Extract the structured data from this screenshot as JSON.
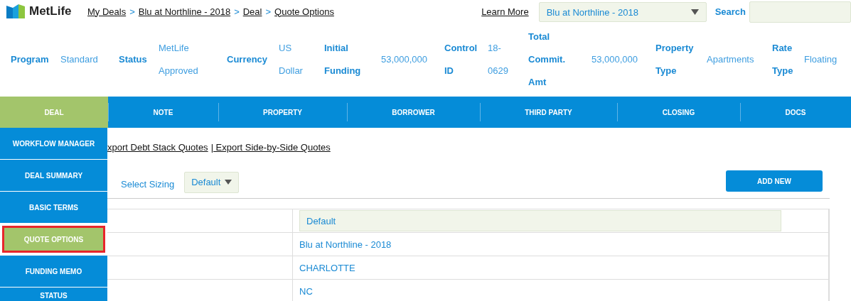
{
  "header": {
    "logo_text": "MetLife",
    "breadcrumb": [
      "My Deals",
      "Blu at Northline - 2018",
      "Deal",
      "Quote Options"
    ],
    "breadcrumb_separator": ">",
    "learn_more": "Learn More",
    "deal_select": "Blu at Northline - 2018",
    "search_label": "Search"
  },
  "summary": [
    {
      "label": "Program",
      "value": "Standard"
    },
    {
      "label": "Status",
      "value": "MetLife Approved"
    },
    {
      "label": "Currency",
      "value": "US Dollar"
    },
    {
      "label": "Initial Funding",
      "value": "53,000,000"
    },
    {
      "label": "Control ID",
      "value": "18-0629"
    },
    {
      "label": "Total Commit. Amt",
      "value": "53,000,000"
    },
    {
      "label": "Property Type",
      "value": "Apartments"
    },
    {
      "label": "Rate Type",
      "value": "Floating"
    }
  ],
  "tabs": [
    {
      "label": "DEAL",
      "selected": true
    },
    {
      "label": "NOTE",
      "selected": false
    },
    {
      "label": "PROPERTY",
      "selected": false
    },
    {
      "label": "BORROWER",
      "selected": false
    },
    {
      "label": "THIRD PARTY",
      "selected": false
    },
    {
      "label": "CLOSING",
      "selected": false
    },
    {
      "label": "DOCS",
      "selected": false
    }
  ],
  "sidebar": {
    "items": [
      {
        "label": "WORKFLOW MANAGER",
        "selected": false,
        "highlighted": false
      },
      {
        "label": "DEAL SUMMARY",
        "selected": false,
        "highlighted": false
      },
      {
        "label": "BASIC TERMS",
        "selected": false,
        "highlighted": false
      },
      {
        "label": "QUOTE OPTIONS",
        "selected": true,
        "highlighted": true
      },
      {
        "label": "FUNDING MEMO",
        "selected": false,
        "highlighted": false
      },
      {
        "label": "STATUS",
        "selected": false,
        "highlighted": false
      }
    ]
  },
  "export_links": [
    "xport Debt Stack Quotes",
    "| Export Side-by-Side Quotes"
  ],
  "sizing": {
    "label": "Select Sizing",
    "value": "Default"
  },
  "add_button": "ADD NEW",
  "table": {
    "header": "Default",
    "rows": [
      "Blu at Northline - 2018",
      "CHARLOTTE",
      "NC"
    ]
  }
}
